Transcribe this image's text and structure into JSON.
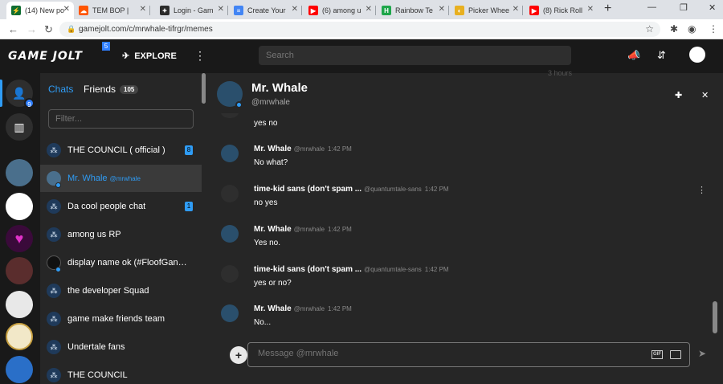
{
  "browser": {
    "tabs": [
      {
        "title": "(14) New po",
        "icon": "gamejolt-tab-icon",
        "color": "#0f6e31"
      },
      {
        "title": "TEM BOP | ",
        "icon": "soundcloud-tab-icon",
        "color": "#ff5500"
      },
      {
        "title": "Login - Gam",
        "icon": "gamejolt-tab-icon",
        "color": "#2b2b2b"
      },
      {
        "title": "Create Your",
        "icon": "docs-tab-icon",
        "color": "#4285f4"
      },
      {
        "title": "(6) among u",
        "icon": "youtube-tab-icon",
        "color": "#ff0000"
      },
      {
        "title": "Rainbow Te",
        "icon": "hello-tab-icon",
        "color": "#1ea64a"
      },
      {
        "title": "Picker Whee",
        "icon": "wheel-tab-icon",
        "color": "#e8b020"
      },
      {
        "title": "(8) Rick Roll",
        "icon": "youtube-tab-icon",
        "color": "#ff0000"
      }
    ],
    "url": "gamejolt.com/c/mrwhale-tifrgr/memes"
  },
  "nav": {
    "logo": "GAME JOLT",
    "logo_badge": "5",
    "explore": "EXPLORE",
    "search_placeholder": "Search"
  },
  "rail": {
    "badge": "9"
  },
  "chatlist": {
    "tab_chats": "Chats",
    "tab_friends": "Friends",
    "friends_count": "105",
    "filter_placeholder": "Filter...",
    "items": [
      {
        "name": "THE COUNCIL ( official )",
        "badge": "8"
      },
      {
        "name": "Mr. Whale",
        "sub": "@mrwhale",
        "selected": true
      },
      {
        "name": "Da cool people chat",
        "badge": "1"
      },
      {
        "name": "among us RP"
      },
      {
        "name": "display name ok (#FloofGang) ..."
      },
      {
        "name": "the developer Squad"
      },
      {
        "name": "game make friends team"
      },
      {
        "name": "Undertale fans"
      },
      {
        "name": "THE COUNCIL"
      }
    ]
  },
  "chat": {
    "name": "Mr. Whale",
    "username": "@mrwhale",
    "ghost_time": "3 hours",
    "messages": [
      {
        "text": "yes no",
        "continuation": true
      },
      {
        "author": "Mr. Whale",
        "user": "@mrwhale",
        "time": "1:42 PM",
        "text": "No what?"
      },
      {
        "author": "time-kid sans (don't spam ...",
        "user": "@quantumtale-sans",
        "time": "1:42 PM",
        "text": "no yes"
      },
      {
        "author": "Mr. Whale",
        "user": "@mrwhale",
        "time": "1:42 PM",
        "text": "Yes no."
      },
      {
        "author": "time-kid sans (don't spam ...",
        "user": "@quantumtale-sans",
        "time": "1:42 PM",
        "text": "yes or no?"
      },
      {
        "author": "Mr. Whale",
        "user": "@mrwhale",
        "time": "1:42 PM",
        "text": "No..."
      }
    ],
    "composer_placeholder": "Message @mrwhale",
    "gif_label": "GIF"
  }
}
